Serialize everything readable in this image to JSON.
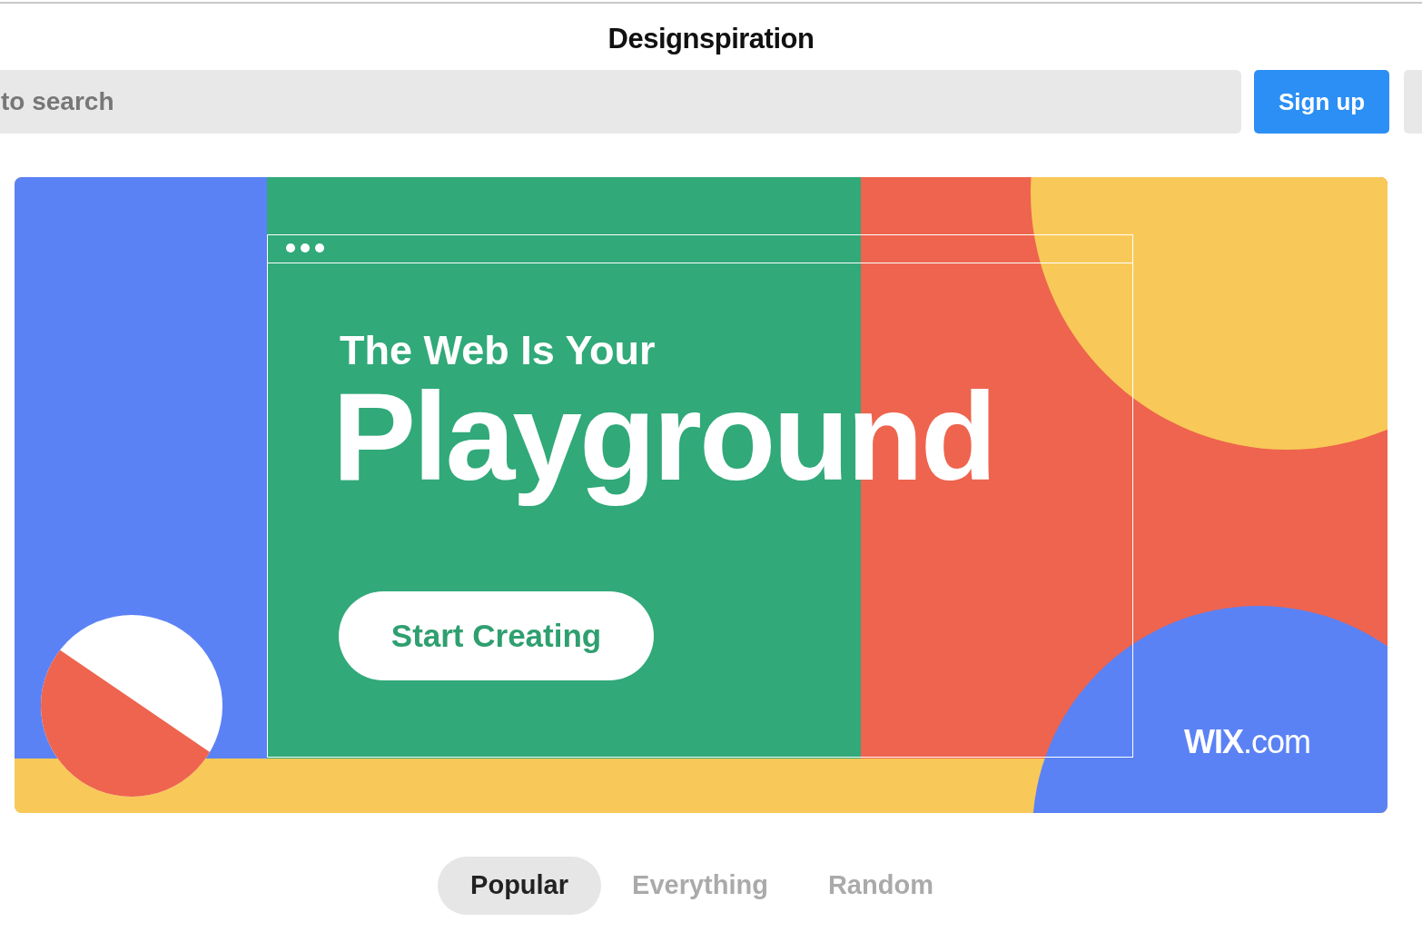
{
  "header": {
    "title": "Designspiration"
  },
  "search": {
    "placeholder": "to search"
  },
  "signup_button": "Sign up",
  "ad": {
    "headline": "The Web Is Your",
    "headline_large": "Playground",
    "button": "Start Creating",
    "logo": "**WIX**.com"
  },
  "tabs": [
    {
      "label": "Popular",
      "selected": true
    },
    {
      "label": "Everything",
      "selected": false
    },
    {
      "label": "Random",
      "selected": false
    }
  ]
}
